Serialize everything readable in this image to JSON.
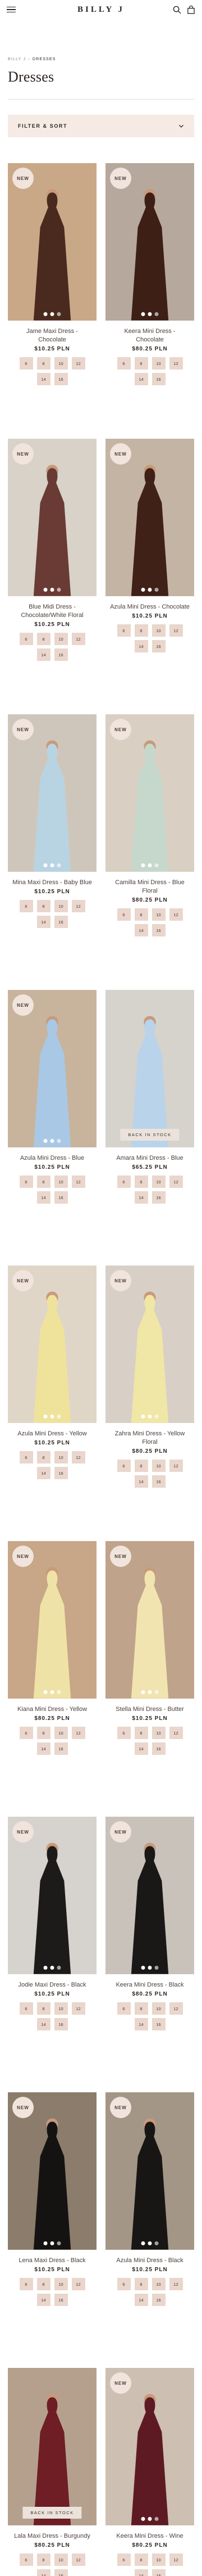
{
  "header": {
    "brand": "BILLY J"
  },
  "breadcrumb": {
    "home": "BILLY J",
    "separator": "›",
    "current": "DRESSES"
  },
  "page": {
    "title": "Dresses"
  },
  "filter": {
    "label": "FILTER & SORT"
  },
  "labels": {
    "new": "NEW",
    "back_in_stock": "BACK IN STOCK"
  },
  "colors": {
    "accent_bg": "#f5ebe4",
    "size_chip": "#ead6cc",
    "size_chip_unavailable": "#f5efeb"
  },
  "products": [
    {
      "name": "Jame Maxi Dress - Chocolate",
      "price": "$10.25 PLN",
      "badge": "NEW",
      "back_in_stock": false,
      "bg": "#c9a888",
      "dress": "#4a2a1e",
      "sizes": [
        "6",
        "8",
        "10",
        "12",
        "14",
        "16"
      ]
    },
    {
      "name": "Keera Mini Dress - Chocolate",
      "price": "$80.25 PLN",
      "badge": "NEW",
      "back_in_stock": false,
      "bg": "#b6a89c",
      "dress": "#3d1f16",
      "sizes": [
        "6",
        "8",
        "10",
        "12",
        "14",
        "16"
      ]
    },
    {
      "name": "Blue Midi Dress - Chocolate/White Floral",
      "price": "$10.25 PLN",
      "badge": "NEW",
      "back_in_stock": false,
      "bg": "#d8d2c8",
      "dress": "#6a3a35",
      "sizes": [
        "6",
        "8",
        "10",
        "12",
        "14",
        "16"
      ]
    },
    {
      "name": "Azula Mini Dress - Chocolate",
      "price": "$10.25 PLN",
      "badge": "NEW",
      "back_in_stock": false,
      "bg": "#c4b4a4",
      "dress": "#3f2118",
      "sizes": [
        "6",
        "8",
        "10",
        "12",
        "14",
        "16"
      ]
    },
    {
      "name": "Mina Maxi Dress - Baby Blue",
      "price": "$10.25 PLN",
      "badge": "NEW",
      "back_in_stock": false,
      "bg": "#cfc6bb",
      "dress": "#b8d4e2",
      "sizes": [
        "6",
        "8",
        "10",
        "12",
        "14",
        "16"
      ]
    },
    {
      "name": "Camilla Mini Dress - Blue Floral",
      "price": "$80.25 PLN",
      "badge": "NEW",
      "back_in_stock": false,
      "bg": "#d9cfc2",
      "dress": "#c6d8cc",
      "sizes": [
        "6",
        "8",
        "10",
        "12",
        "14",
        "16"
      ]
    },
    {
      "name": "Azula Mini Dress - Blue",
      "price": "$10.25 PLN",
      "badge": "NEW",
      "back_in_stock": false,
      "bg": "#c8b49c",
      "dress": "#a9c8e6",
      "sizes": [
        "6",
        "8",
        "10",
        "12",
        "14",
        "16"
      ]
    },
    {
      "name": "Amara Mini Dress - Blue",
      "price": "$65.25 PLN",
      "badge": "",
      "back_in_stock": true,
      "bg": "#d6d2cc",
      "dress": "#b9d3ea",
      "sizes": [
        "6",
        "8",
        "10",
        "12",
        "14",
        "16"
      ]
    },
    {
      "name": "Azula Mini Dress - Yellow",
      "price": "$10.25 PLN",
      "badge": "NEW",
      "back_in_stock": false,
      "bg": "#dfd6c8",
      "dress": "#efe39c",
      "sizes": [
        "6",
        "8",
        "10",
        "12",
        "14",
        "16"
      ]
    },
    {
      "name": "Zahra Mini Dress - Yellow Floral",
      "price": "$80.25 PLN",
      "badge": "NEW",
      "back_in_stock": false,
      "bg": "#d8d0c6",
      "dress": "#f0e6a6",
      "sizes": [
        "6",
        "8",
        "10",
        "12",
        "14",
        "16"
      ]
    },
    {
      "name": "Kiana Mini Dress - Yellow",
      "price": "$80.25 PLN",
      "badge": "NEW",
      "back_in_stock": false,
      "bg": "#c8a688",
      "dress": "#efe2a6",
      "sizes": [
        "6",
        "8",
        "10",
        "12",
        "14",
        "16"
      ]
    },
    {
      "name": "Stella Mini Dress - Butter",
      "price": "$10.25 PLN",
      "badge": "NEW",
      "back_in_stock": false,
      "bg": "#bfa38a",
      "dress": "#f1e4b0",
      "sizes": [
        "6",
        "8",
        "10",
        "12",
        "14",
        "16"
      ]
    },
    {
      "name": "Jodie Maxi Dress - Black",
      "price": "$10.25 PLN",
      "badge": "NEW",
      "back_in_stock": false,
      "bg": "#d6d2cd",
      "dress": "#1d1b1a",
      "sizes": [
        "6",
        "8",
        "10",
        "12",
        "14",
        "16"
      ]
    },
    {
      "name": "Keera Mini Dress - Black",
      "price": "$80.25 PLN",
      "badge": "NEW",
      "back_in_stock": false,
      "bg": "#c9c2bb",
      "dress": "#1a1817",
      "sizes": [
        "6",
        "8",
        "10",
        "12",
        "14",
        "16"
      ]
    },
    {
      "name": "Lena Maxi Dress - Black",
      "price": "$10.25 PLN",
      "badge": "NEW",
      "back_in_stock": false,
      "bg": "#8b7c6c",
      "dress": "#151312",
      "sizes": [
        "6",
        "8",
        "10",
        "12",
        "14",
        "16"
      ]
    },
    {
      "name": "Azula Mini Dress - Black",
      "price": "$10.25 PLN",
      "badge": "NEW",
      "back_in_stock": false,
      "bg": "#a49686",
      "dress": "#181615",
      "sizes": [
        "6",
        "8",
        "10",
        "12",
        "14",
        "16"
      ]
    },
    {
      "name": "Lala Maxi Dress - Burgundy",
      "price": "$80.25 PLN",
      "badge": "",
      "back_in_stock": true,
      "bg": "#b5a08e",
      "dress": "#6e1e24",
      "sizes": [
        "6",
        "8",
        "10",
        "12",
        "14",
        "16"
      ]
    },
    {
      "name": "Keera Mini Dress - Wine",
      "price": "$80.25 PLN",
      "badge": "NEW",
      "back_in_stock": false,
      "bg": "#cdbfb2",
      "dress": "#5e1a22",
      "sizes": [
        "6",
        "8",
        "10",
        "12",
        "14",
        "16"
      ]
    },
    {
      "name": "",
      "price": "",
      "badge": "",
      "back_in_stock": false,
      "bg": "#c4a588",
      "dress": "#7a2226",
      "sizes": []
    },
    {
      "name": "",
      "price": "",
      "badge": "",
      "back_in_stock": false,
      "bg": "#b8988a",
      "dress": "#6b1d22",
      "sizes": []
    }
  ]
}
